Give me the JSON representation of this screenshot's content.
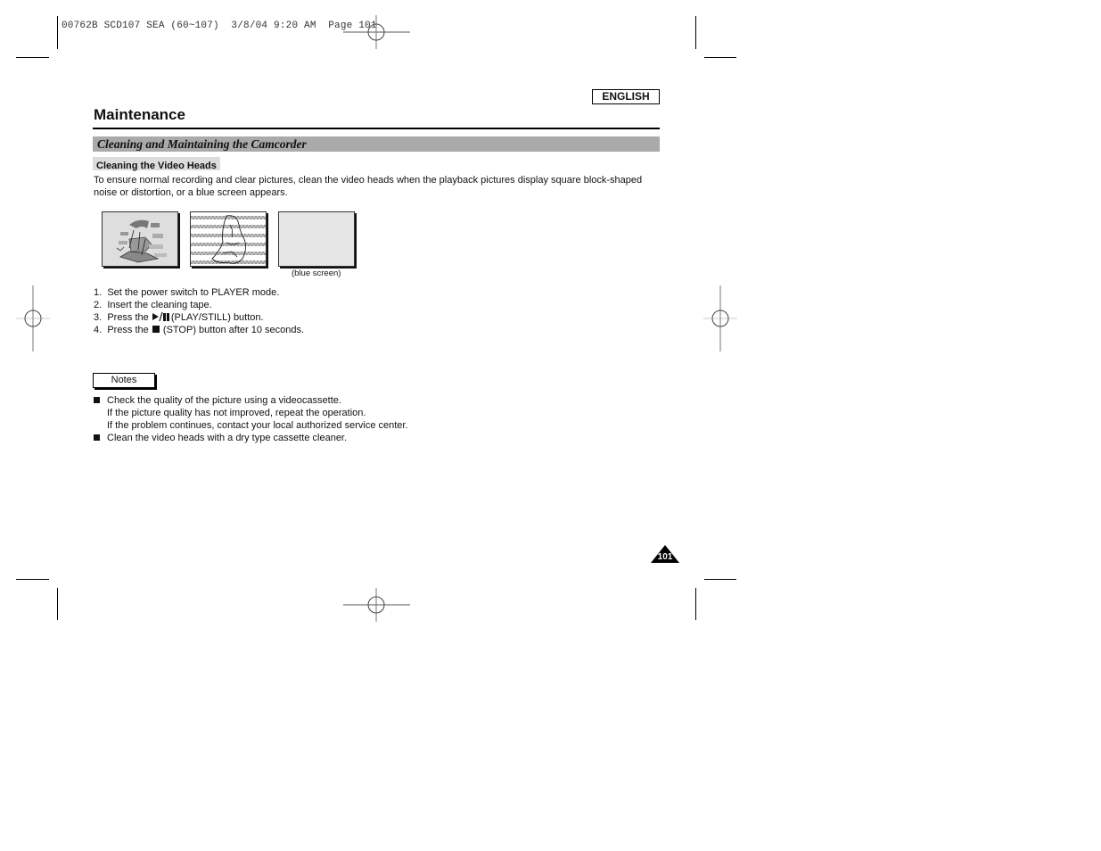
{
  "print_slug": "00762B SCD107 SEA (60~107)  3/8/04 9:20 AM  Page 101",
  "language_badge": "ENGLISH",
  "page_title": "Maintenance",
  "section_title": "Cleaning and Maintaining the Camcorder",
  "subsection_title": "Cleaning the Video Heads",
  "intro_text": "To ensure normal recording and clear pictures, clean the video heads when the playback pictures display square block-shaped noise or distortion, or a blue screen appears.",
  "illustrations": [
    {
      "name": "block-noise-picture",
      "caption": ""
    },
    {
      "name": "distorted-picture",
      "caption": ""
    },
    {
      "name": "blue-screen-picture",
      "caption": "(blue screen)"
    }
  ],
  "steps": [
    {
      "num": "1.",
      "before": "Set the power switch to PLAYER mode.",
      "icon": "",
      "after": ""
    },
    {
      "num": "2.",
      "before": "Insert the cleaning tape.",
      "icon": "",
      "after": ""
    },
    {
      "num": "3.",
      "before": "Press the ",
      "icon": "play-pause-icon",
      "after": "(PLAY/STILL) button."
    },
    {
      "num": "4.",
      "before": "Press the ",
      "icon": "stop-icon",
      "after": " (STOP) button after 10 seconds."
    }
  ],
  "notes_label": "Notes",
  "notes": [
    {
      "lines": [
        "Check the quality of the picture using a videocassette.",
        "If the picture quality has not improved, repeat the operation.",
        "If the problem continues, contact your local authorized service center."
      ]
    },
    {
      "lines": [
        "Clean the video heads with a dry type cassette cleaner."
      ]
    }
  ],
  "page_number": "101"
}
